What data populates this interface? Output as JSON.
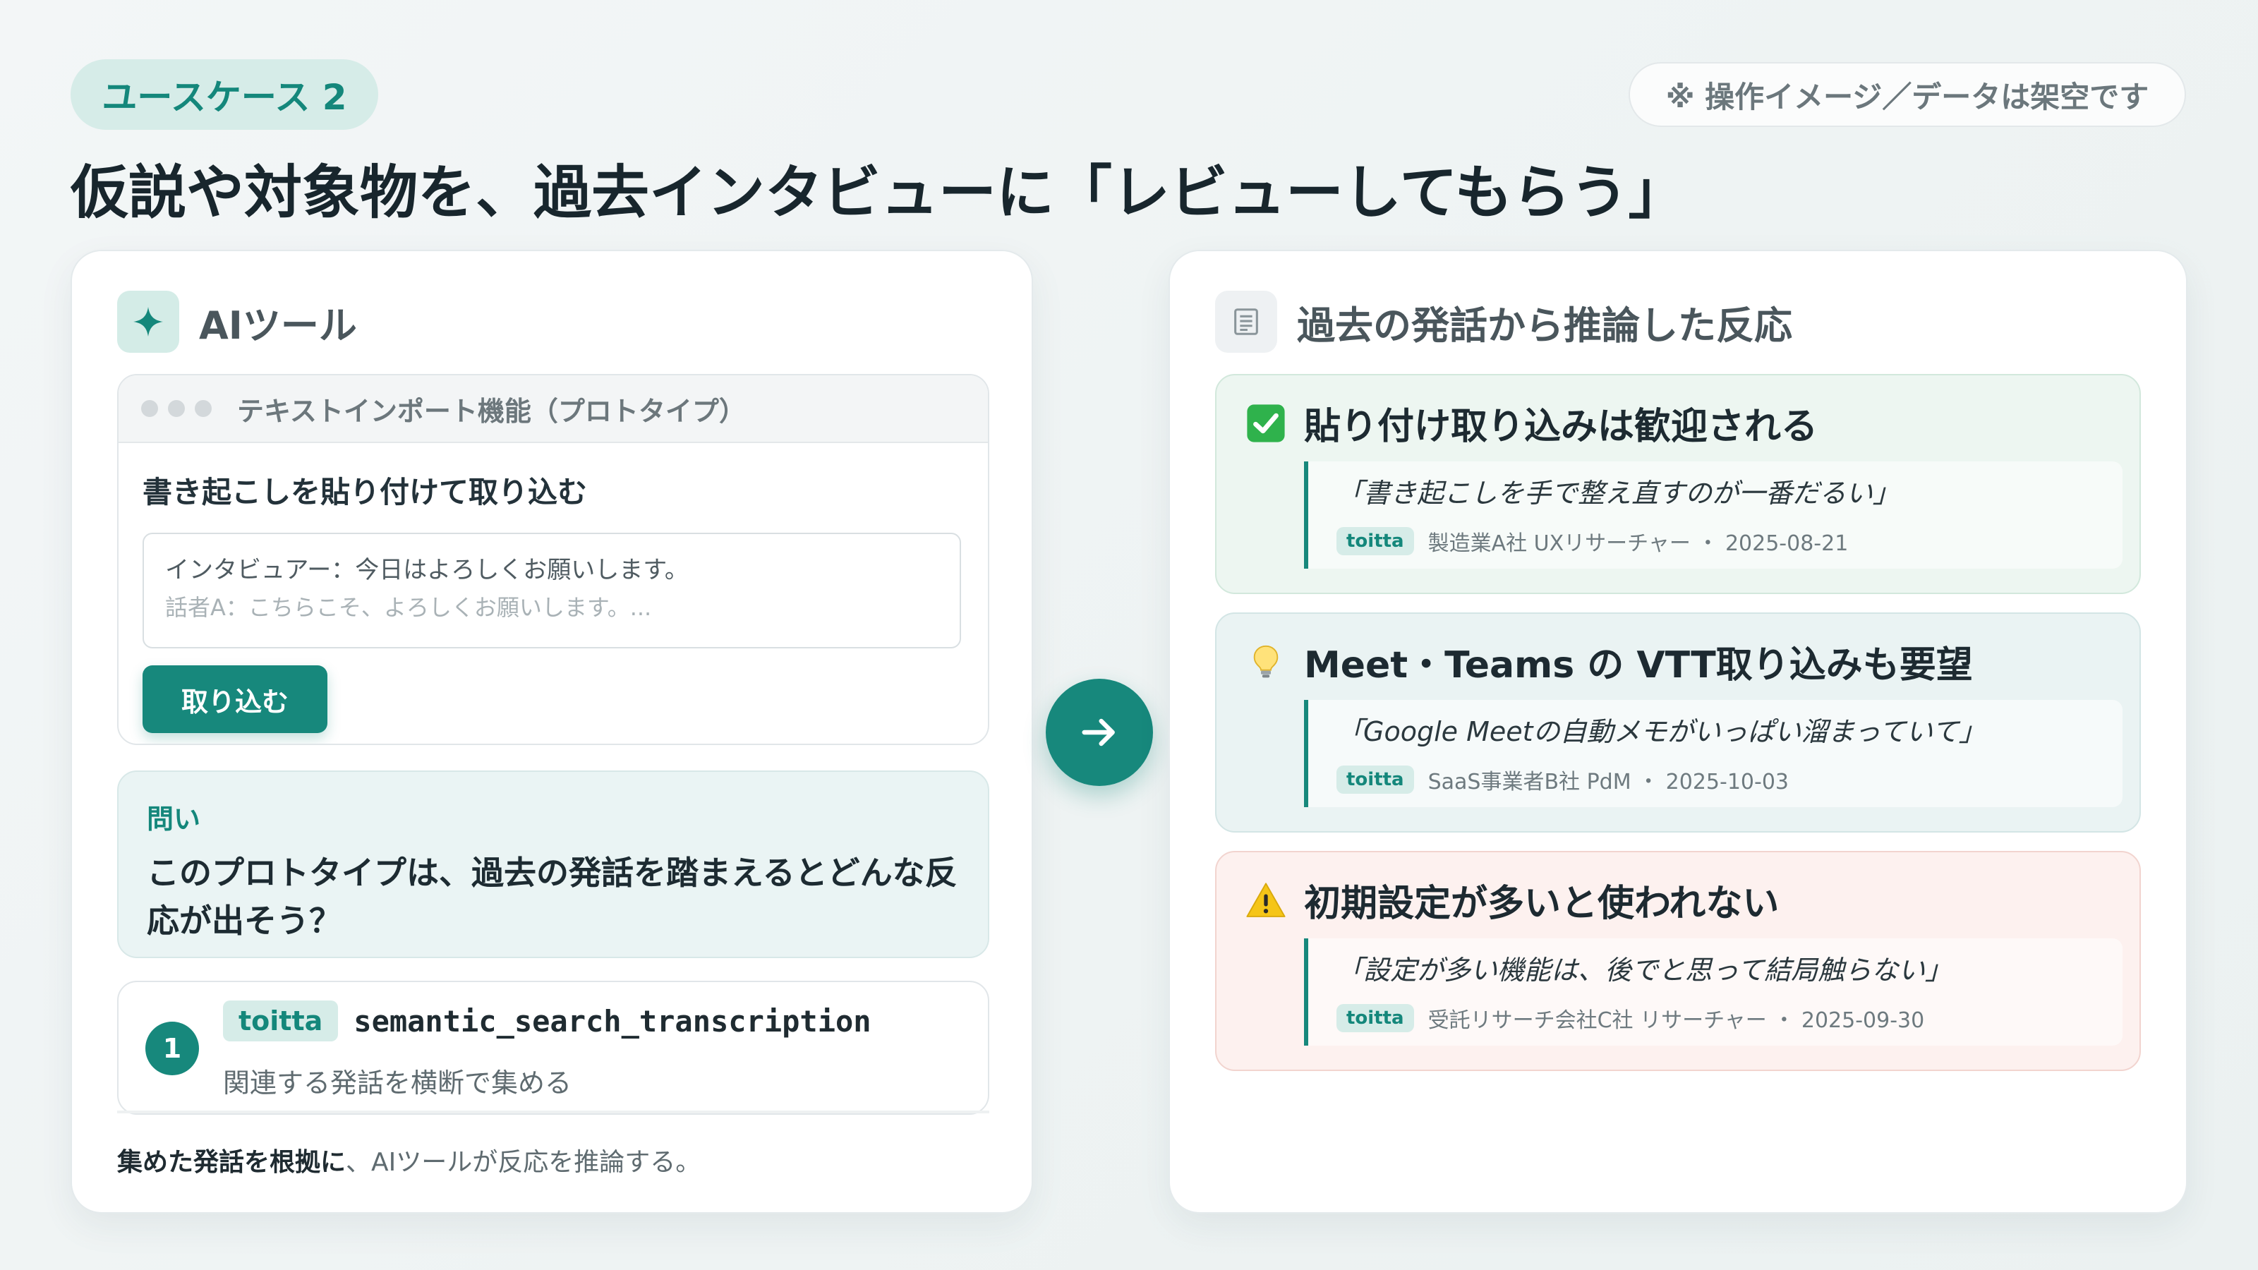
{
  "header": {
    "usecase_label": "ユースケース 2",
    "disclaimer": "※ 操作イメージ／データは架空です",
    "headline": "仮説や対象物を、過去インタビューに「レビューしてもらう」"
  },
  "left_panel": {
    "title": "AIツール",
    "icon": "sparkle-icon",
    "prototype": {
      "window_title": "テキストインポート機能（プロトタイプ）",
      "heading": "書き起こしを貼り付けて取り込む",
      "textarea_line1": "インタビュアー：今日はよろしくお願いします。",
      "textarea_line2": "話者A：こちらこそ、よろしくお願いします。...",
      "import_button": "取り込む"
    },
    "question": {
      "label": "問い",
      "text": "このプロトタイプは、過去の発話を踏まえるとどんな反応が出そう？"
    },
    "tool_step": {
      "number": "1",
      "chip": "toitta",
      "tool_name": "semantic_search_transcription",
      "description": "関連する発話を横断で集める"
    },
    "summary_bold": "集めた発話を根拠に",
    "summary_rest": "、AIツールが反応を推論する。"
  },
  "arrow": {
    "icon": "arrow-right-icon"
  },
  "right_panel": {
    "title": "過去の発話から推論した反応",
    "icon": "document-icon",
    "findings": [
      {
        "icon": "check-mark-icon",
        "title": "貼り付け取り込みは歓迎される",
        "quote": "「書き起こしを手で整え直すのが一番だるい」",
        "chip": "toitta",
        "source": "製造業A社 UXリサーチャー ・ 2025-08-21"
      },
      {
        "icon": "lightbulb-icon",
        "title": "Meet・Teams の VTT取り込みも要望",
        "quote": "「Google Meetの自動メモがいっぱい溜まっていて」",
        "chip": "toitta",
        "source": "SaaS事業者B社 PdM ・ 2025-10-03"
      },
      {
        "icon": "warning-icon",
        "title": "初期設定が多いと使われない",
        "quote": "「設定が多い機能は、後でと思って結局触らない」",
        "chip": "toitta",
        "source": "受託リサーチ会社C社 リサーチャー ・ 2025-09-30"
      }
    ]
  },
  "colors": {
    "accent": "#17887c",
    "accent_light": "#d6ece8",
    "positive_bg": "#edf6f1",
    "info_bg": "#eaf3f3",
    "warning_bg": "#fdf1ef"
  }
}
